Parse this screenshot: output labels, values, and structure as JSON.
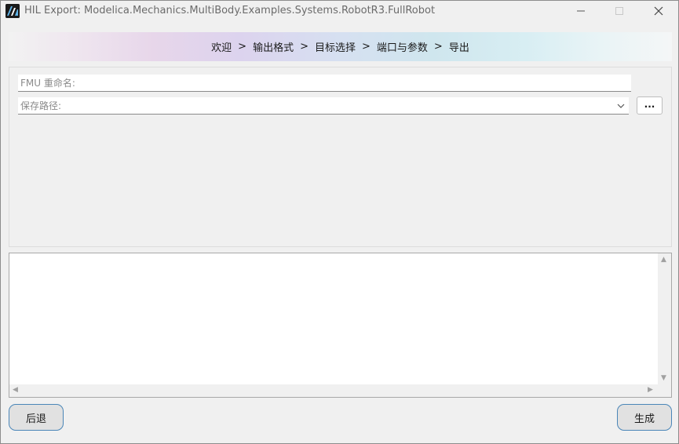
{
  "window": {
    "title": "HIL Export: Modelica.Mechanics.MultiBody.Examples.Systems.RobotR3.FullRobot",
    "app_icon": "app-logo-icon",
    "controls": {
      "minimize": "—",
      "maximize": "☐",
      "close": "✕"
    }
  },
  "breadcrumb": {
    "steps": [
      "欢迎",
      "输出格式",
      "目标选择",
      "端口与参数",
      "导出"
    ],
    "separator": ">"
  },
  "form": {
    "fmu_rename": {
      "placeholder": "FMU 重命名:",
      "value": ""
    },
    "save_path": {
      "placeholder": "保存路径:",
      "value": ""
    },
    "browse_label": "..."
  },
  "log": {
    "text": ""
  },
  "buttons": {
    "back": "后退",
    "generate": "生成"
  },
  "colors": {
    "button_border": "#4a86b8",
    "window_bg": "#f0f0f0"
  }
}
